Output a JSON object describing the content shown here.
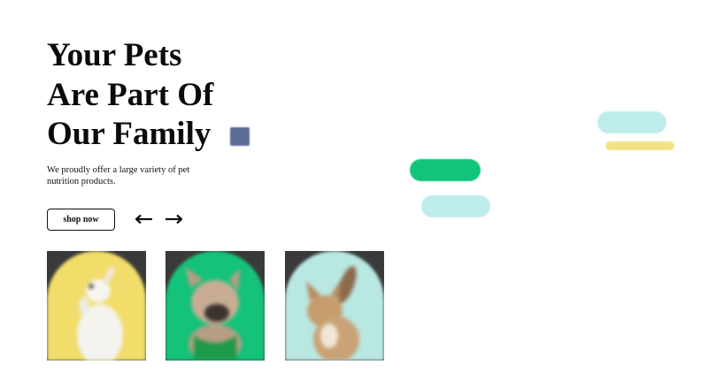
{
  "hero": {
    "title_lines": [
      "Your Pets",
      "Are Part Of",
      "Our Family"
    ],
    "subtitle": "We proudly offer a large variety of pet nutrition products."
  },
  "actions": {
    "shop_label": "shop now",
    "prev_icon": "arrow-left-icon",
    "next_icon": "arrow-right-icon"
  },
  "pet_cards": [
    {
      "animal": "rabbit",
      "bg": "#f2dc6a"
    },
    {
      "animal": "french bulldog",
      "bg": "#15c27a"
    },
    {
      "animal": "cat",
      "bg": "#b9e8e2"
    }
  ],
  "colors": {
    "text": "#0b0b0b",
    "card_frame": "#3a3a3a",
    "accent_green": "#11c47a",
    "accent_mint": "#bdeceb",
    "accent_yellow": "#f2e284",
    "badge": "#5c6a96"
  }
}
